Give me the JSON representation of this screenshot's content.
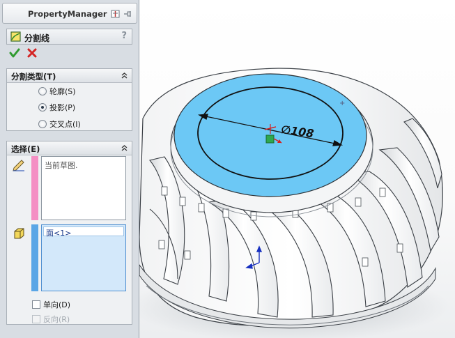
{
  "property_manager": {
    "title": "PropertyManager",
    "feature_title": "分割线",
    "help": "?",
    "split_type": {
      "header": "分割类型(T)",
      "options": [
        {
          "label": "轮廓(S)",
          "checked": false
        },
        {
          "label": "投影(P)",
          "checked": true
        },
        {
          "label": "交叉点(I)",
          "checked": false
        }
      ]
    },
    "selection": {
      "header": "选择(E)",
      "sketch_list": {
        "item": "当前草图.",
        "bar_color": "#f48fc4"
      },
      "face_list": {
        "item": "面<1>",
        "bar_color": "#5aa6e6"
      },
      "single_direction": {
        "label": "单向(D)",
        "checked": false
      },
      "reverse_direction": {
        "label": "反向(R)",
        "checked": false,
        "enabled": false
      }
    }
  },
  "viewport": {
    "dimension_label": "∅108",
    "face_color": "#6cc8f5"
  }
}
